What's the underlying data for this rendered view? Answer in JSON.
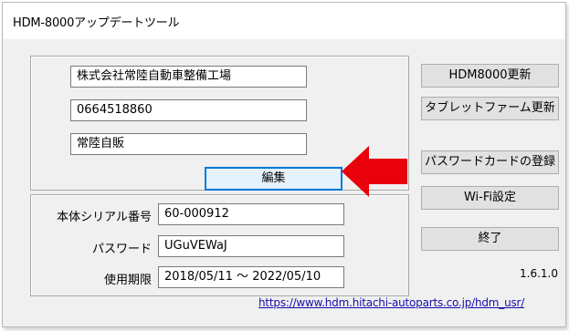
{
  "window": {
    "title": "HDM-8000アップデートツール"
  },
  "company": {
    "name": "株式会社常陸自動車整備工場",
    "phone": "0664518860",
    "short_name": "常陸自販",
    "edit_button": "編集"
  },
  "device": {
    "serial_label": "本体シリアル番号",
    "serial_value": "60-000912",
    "password_label": "パスワード",
    "password_value": "UGuVEWaJ",
    "expiry_label": "使用期限",
    "expiry_value": "2018/05/11 ～ 2022/05/10"
  },
  "buttons": {
    "hdm_update": "HDM8000更新",
    "tablet_firmware": "タブレットファーム更新",
    "password_card": "パスワードカードの登録",
    "wifi": "Wi-Fi設定",
    "exit": "終了"
  },
  "version": "1.6.1.0",
  "link": "https://www.hdm.hitachi-autoparts.co.jp/hdm_usr/",
  "annotation": {
    "arrow_color": "#e8000b",
    "arrow_direction": "left"
  }
}
